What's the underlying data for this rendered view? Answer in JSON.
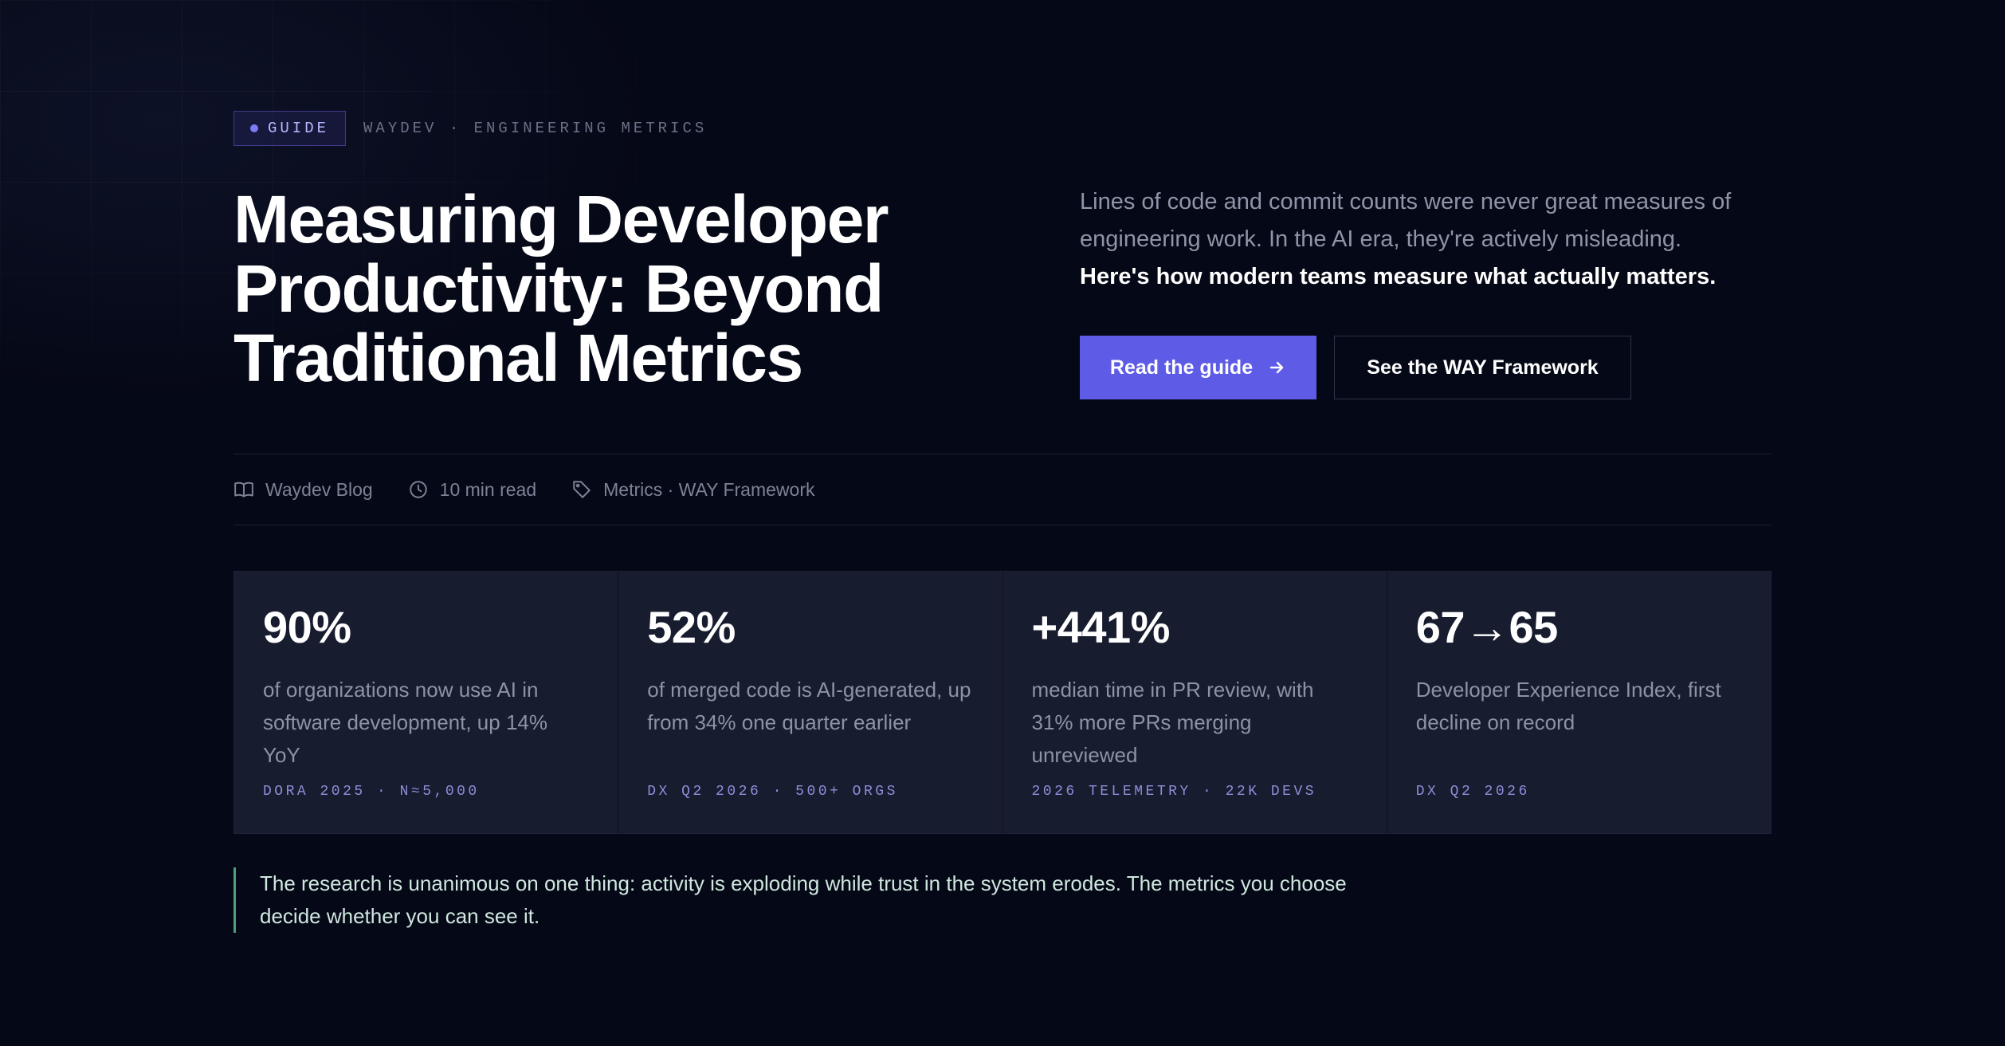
{
  "tag": {
    "badge": "GUIDE",
    "crumb": "WAYDEV · ENGINEERING METRICS"
  },
  "hero": {
    "title_lines": [
      "Measuring Developer",
      "Productivity: Beyond",
      "Traditional Metrics"
    ],
    "lede": "Lines of code and commit counts were never great measures of engineering work. In the AI era, they're actively misleading.",
    "lede_strong": "Here's how modern teams measure what actually matters.",
    "primary_button": "Read the guide",
    "secondary_button": "See the WAY Framework"
  },
  "meta": {
    "blog": "Waydev Blog",
    "read_time": "10 min read",
    "tags": "Metrics · WAY Framework"
  },
  "stats": [
    {
      "value": "90%",
      "desc": "of organizations now use AI in software development, up 14% YoY",
      "source": "DORA 2025 · N≈5,000"
    },
    {
      "value": "52%",
      "desc": "of merged code is AI-generated, up from 34% one quarter earlier",
      "source": "DX Q2 2026 · 500+ ORGS"
    },
    {
      "value": "+441%",
      "desc": "median time in PR review, with 31% more PRs merging unreviewed",
      "source": "2026 TELEMETRY · 22K DEVS"
    },
    {
      "value": "67→65",
      "desc": "Developer Experience Index, first decline on record",
      "source": "DX Q2 2026"
    }
  ],
  "quote": "The research is unanimous on one thing: activity is exploding while trust in the system erodes. The metrics you choose decide whether you can see it.",
  "colors": {
    "accent": "#5e5ce6",
    "background": "#050816",
    "quote_border": "#4f9e7e"
  }
}
